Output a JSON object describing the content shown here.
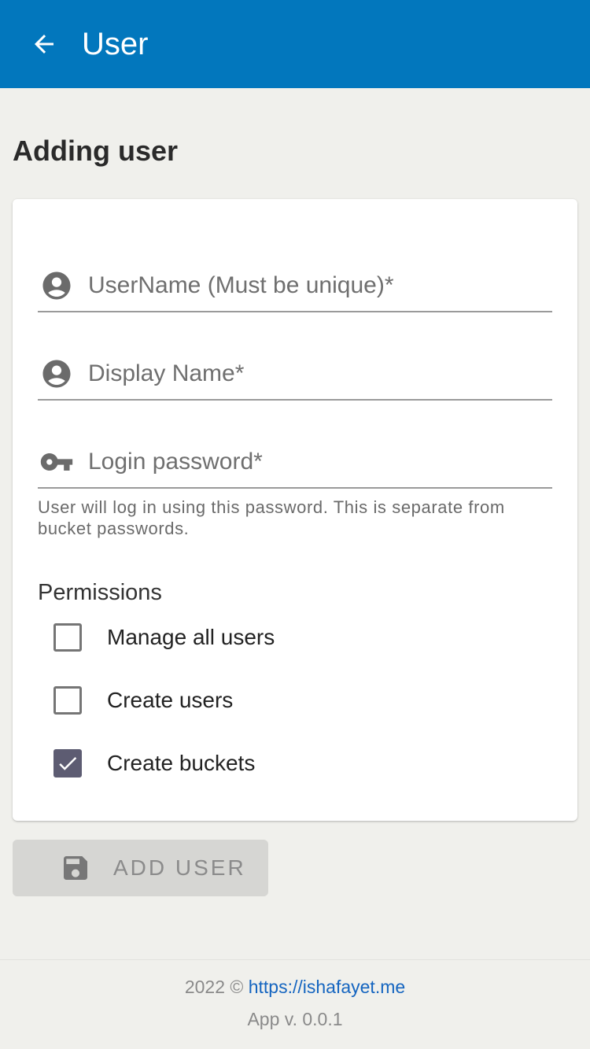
{
  "appbar": {
    "title": "User",
    "back_icon": "arrow-left-icon",
    "color": "#0277bd"
  },
  "page": {
    "title": "Adding user"
  },
  "form": {
    "username": {
      "placeholder": "UserName (Must be unique)*",
      "value": "",
      "icon": "account-circle-icon"
    },
    "display_name": {
      "placeholder": "Display Name*",
      "value": "",
      "icon": "account-circle-icon"
    },
    "password": {
      "placeholder": "Login password*",
      "value": "",
      "icon": "key-icon",
      "helper": "User will log in using this password. This is separate from bucket passwords."
    },
    "permissions": {
      "label": "Permissions",
      "items": [
        {
          "label": "Manage all users",
          "checked": false
        },
        {
          "label": "Create users",
          "checked": false
        },
        {
          "label": "Create buckets",
          "checked": true
        }
      ]
    }
  },
  "actions": {
    "add_user_label": "ADD USER",
    "add_user_icon": "floppy-disk-icon",
    "disabled": true
  },
  "footer": {
    "year_prefix": "2022 ©",
    "link_text": "https://ishafayet.me",
    "version": "App v. 0.0.1",
    "link_color": "#1565c0"
  }
}
